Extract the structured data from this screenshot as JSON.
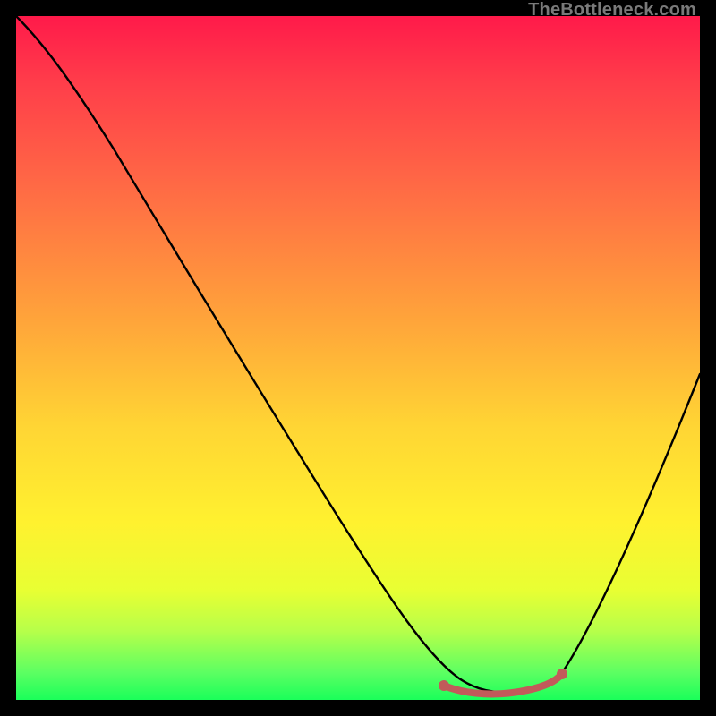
{
  "watermark": "TheBottleneck.com",
  "chart_data": {
    "type": "line",
    "title": "",
    "xlabel": "",
    "ylabel": "",
    "xlim": [
      0,
      100
    ],
    "ylim": [
      0,
      100
    ],
    "background_gradient": {
      "stops": [
        {
          "pos": 0.0,
          "color": "#ff1a4a"
        },
        {
          "pos": 0.1,
          "color": "#ff3e4a"
        },
        {
          "pos": 0.25,
          "color": "#ff6a45"
        },
        {
          "pos": 0.45,
          "color": "#ffa63a"
        },
        {
          "pos": 0.6,
          "color": "#ffd534"
        },
        {
          "pos": 0.74,
          "color": "#fff12f"
        },
        {
          "pos": 0.84,
          "color": "#e8ff33"
        },
        {
          "pos": 0.9,
          "color": "#b6ff4a"
        },
        {
          "pos": 0.96,
          "color": "#5cff62"
        },
        {
          "pos": 1.0,
          "color": "#1aff5a"
        }
      ]
    },
    "series": [
      {
        "name": "bottleneck-curve",
        "color": "#000000",
        "points": [
          {
            "x": 0,
            "y": 100
          },
          {
            "x": 5,
            "y": 97
          },
          {
            "x": 12,
            "y": 88
          },
          {
            "x": 25,
            "y": 67
          },
          {
            "x": 40,
            "y": 42
          },
          {
            "x": 50,
            "y": 25
          },
          {
            "x": 57,
            "y": 12
          },
          {
            "x": 62,
            "y": 5
          },
          {
            "x": 66,
            "y": 2
          },
          {
            "x": 70,
            "y": 1
          },
          {
            "x": 75,
            "y": 1
          },
          {
            "x": 79,
            "y": 3
          },
          {
            "x": 84,
            "y": 12
          },
          {
            "x": 90,
            "y": 26
          },
          {
            "x": 95,
            "y": 38
          },
          {
            "x": 100,
            "y": 50
          }
        ]
      }
    ],
    "highlight": {
      "color": "#c25a5a",
      "segment_x": [
        62,
        79
      ],
      "dots": [
        {
          "x": 62,
          "y": 5
        },
        {
          "x": 79,
          "y": 3
        }
      ]
    }
  }
}
